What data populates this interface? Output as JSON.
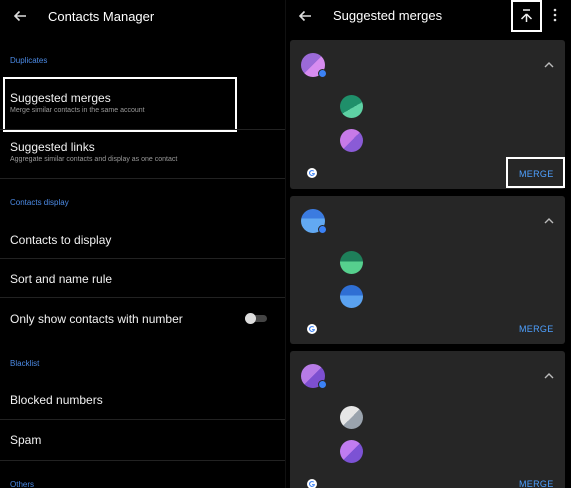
{
  "left": {
    "title": "Contacts Manager",
    "sections": {
      "duplicates": "Duplicates",
      "contacts_display": "Contacts display",
      "blacklist": "Blacklist",
      "others": "Others"
    },
    "items": {
      "suggested_merges": {
        "label": "Suggested merges",
        "sub": "Merge similar contacts in the same account"
      },
      "suggested_links": {
        "label": "Suggested links",
        "sub": "Aggregate similar contacts and display as one contact"
      },
      "contacts_to_display": {
        "label": "Contacts to display"
      },
      "sort_and_name_rule": {
        "label": "Sort and name rule"
      },
      "only_show_with_number": {
        "label": "Only show contacts with number",
        "enabled": false
      },
      "blocked_numbers": {
        "label": "Blocked numbers"
      },
      "spam": {
        "label": "Spam"
      }
    }
  },
  "right": {
    "title": "Suggested merges",
    "cards": [
      {
        "merge_label": "MERGE"
      },
      {
        "merge_label": "MERGE"
      },
      {
        "merge_label": "MERGE"
      }
    ]
  },
  "icons": {
    "back": "arrow-left-icon",
    "merge_top": "merge-arrows-icon",
    "overflow": "more-vertical-icon",
    "expand": "chevron-up-icon",
    "google": "google-account-icon"
  },
  "colors": {
    "accent": "#4c8be6",
    "merge": "#4ea0ff",
    "card": "#262626"
  }
}
